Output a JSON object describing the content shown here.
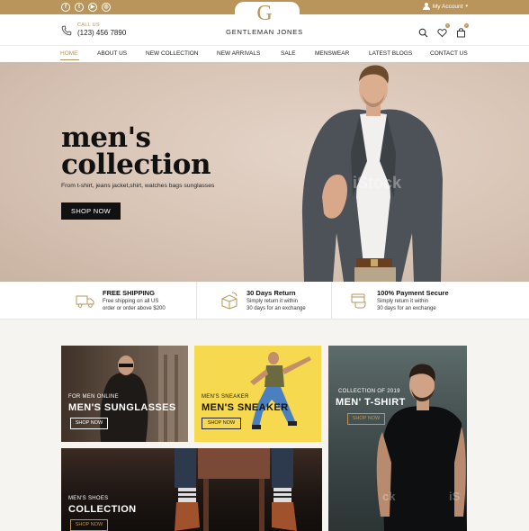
{
  "top_bar": {
    "social": [
      {
        "icon": "facebook-icon",
        "glyph": "f"
      },
      {
        "icon": "twitter-icon",
        "glyph": "t"
      },
      {
        "icon": "youtube-icon",
        "glyph": "▶"
      },
      {
        "icon": "instagram-icon",
        "glyph": "◎"
      }
    ],
    "account_label": "My Account"
  },
  "header": {
    "call_label": "CALL US",
    "phone_number": "(123) 456 7890",
    "logo_letter": "G",
    "brand_name": "GENTLEMAN JONES",
    "wishlist_count": "0",
    "cart_count": "0"
  },
  "nav": {
    "items": [
      "HOME",
      "ABOUT US",
      "NEW COLLECTION",
      "NEW ARRIVALS",
      "SALE",
      "MENSWEAR",
      "LATEST BLOGS",
      "CONTACT US"
    ],
    "active": "HOME"
  },
  "hero": {
    "title_line1": "men's",
    "title_line2": "collection",
    "subtitle": "From t-shirt, jeans jacket,shirt, watches bags sunglasses",
    "button": "SHOP NOW"
  },
  "features": [
    {
      "title": "FREE SHIPPING",
      "line1": "Free shipping on all US",
      "line2": "order or order above $200",
      "icon": "truck-icon"
    },
    {
      "title": "30 Days Return",
      "line1": "Simply return it within",
      "line2": "30 days for an exchange",
      "icon": "return-box-icon"
    },
    {
      "title": "100% Payment Secure",
      "line1": "Simply return it within",
      "line2": "30 days for an exchange",
      "icon": "secure-payment-icon"
    }
  ],
  "banners": {
    "sunglasses": {
      "tag": "FOR MEN ONLINE",
      "title": "MEN'S SUNGLASSES",
      "button": "SHOP NOW"
    },
    "sneaker": {
      "tag": "MEN'S SNEAKER",
      "title": "MEN'S SNEAKER",
      "button": "SHOP NOW"
    },
    "tshirt": {
      "tag": "COLLECTION OF 2019",
      "title": "MEN' T-SHIRT",
      "button": "SHOP NOW"
    },
    "shoes": {
      "tag": "MEN'S SHOES",
      "title": "COLLECTION",
      "button": "SHOP NOW"
    }
  },
  "colors": {
    "accent": "#b9955b",
    "dark": "#111111",
    "hero_bg": "#d8c4b5",
    "sneaker_bg": "#f6d94e"
  }
}
